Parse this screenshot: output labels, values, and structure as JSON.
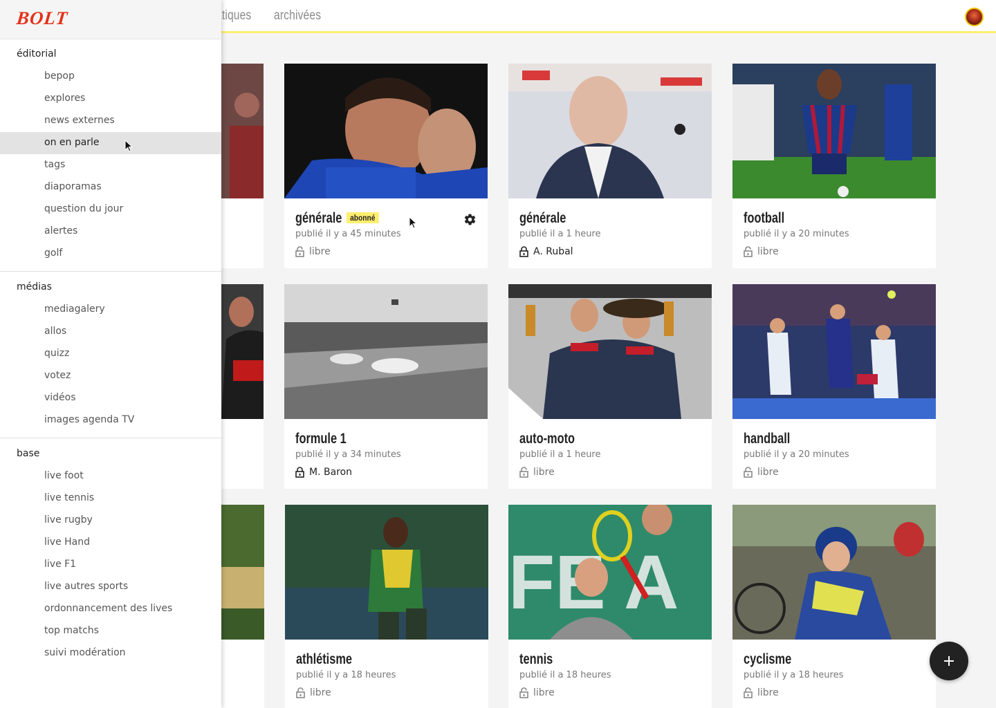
{
  "topbar": {
    "tabs": [
      {
        "label": "atiques"
      },
      {
        "label": "archivées"
      }
    ]
  },
  "cards": [
    {
      "title": "",
      "date": "",
      "status": ""
    },
    {
      "title": "générale",
      "badge": "abonné",
      "date": "publié il y a 45 minutes",
      "status": "libre",
      "locked": false
    },
    {
      "title": "générale",
      "date": "publié il a 1 heure",
      "status": "A. Rubal",
      "locked": true
    },
    {
      "title": "football",
      "date": "publié il y a 20 minutes",
      "status": "libre",
      "locked": false
    },
    {
      "title": "",
      "date": "",
      "status": ""
    },
    {
      "title": "formule 1",
      "date": "publié il y a 34 minutes",
      "status": "M. Baron",
      "locked": true
    },
    {
      "title": "auto-moto",
      "date": "publié il a 1 heure",
      "status": "libre",
      "locked": false
    },
    {
      "title": "handball",
      "date": "publié il y a 20 minutes",
      "status": "libre",
      "locked": false
    },
    {
      "title": "",
      "date": "",
      "status": ""
    },
    {
      "title": "athlétisme",
      "date": "publié il y a 18 heures",
      "status": "libre",
      "locked": false
    },
    {
      "title": "tennis",
      "date": "publié il a 18 heures",
      "status": "libre",
      "locked": false
    },
    {
      "title": "cyclisme",
      "date": "publié il y a 18 heures",
      "status": "libre",
      "locked": false
    }
  ],
  "drawer": {
    "logo": "BOLT",
    "sections": [
      {
        "title": "éditorial",
        "items": [
          "bepop",
          "explores",
          "news externes",
          "on en parle",
          "tags",
          "diaporamas",
          "question du jour",
          "alertes",
          "golf"
        ]
      },
      {
        "title": "médias",
        "items": [
          "mediagalery",
          "allos",
          "quizz",
          "votez",
          "vidéos",
          "images agenda TV"
        ]
      },
      {
        "title": "base",
        "items": [
          "live foot",
          "live tennis",
          "live rugby",
          "live Hand",
          "live F1",
          "live autres sports",
          "ordonnancement des lives",
          "top matchs",
          "suivi modération"
        ]
      }
    ]
  },
  "colors": {
    "accent_yellow": "#ffee6e",
    "logo_red": "#e2321b",
    "fab": "#222222"
  },
  "icons": {
    "lock": "lock-icon",
    "unlock": "unlock-icon",
    "settings": "gear-icon",
    "add": "plus-icon"
  }
}
